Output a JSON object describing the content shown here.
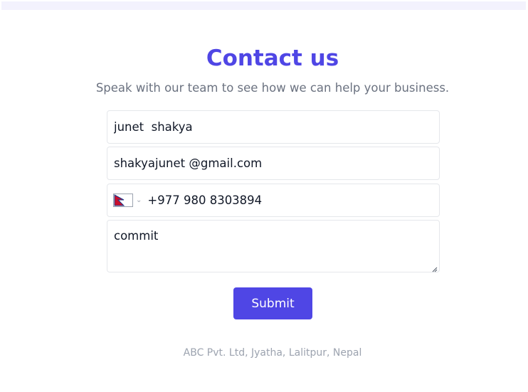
{
  "header": {
    "title": "Contact us",
    "subtitle": "Speak with our team to see how we can help your business."
  },
  "form": {
    "name_value": "junet  shakya",
    "email_value": "shakyajunet @gmail.com",
    "phone": {
      "country_flag": "nepal-flag-icon",
      "value": "+977 980 8303894"
    },
    "message_value": "commit",
    "submit_label": "Submit"
  },
  "footer": {
    "address": "ABC Pvt. Ltd, Jyatha, Lalitpur, Nepal"
  },
  "colors": {
    "accent": "#4f46e5",
    "subtitle_text": "#6b7280",
    "footer_text": "#9ca3af",
    "field_border": "#e5e7eb"
  }
}
